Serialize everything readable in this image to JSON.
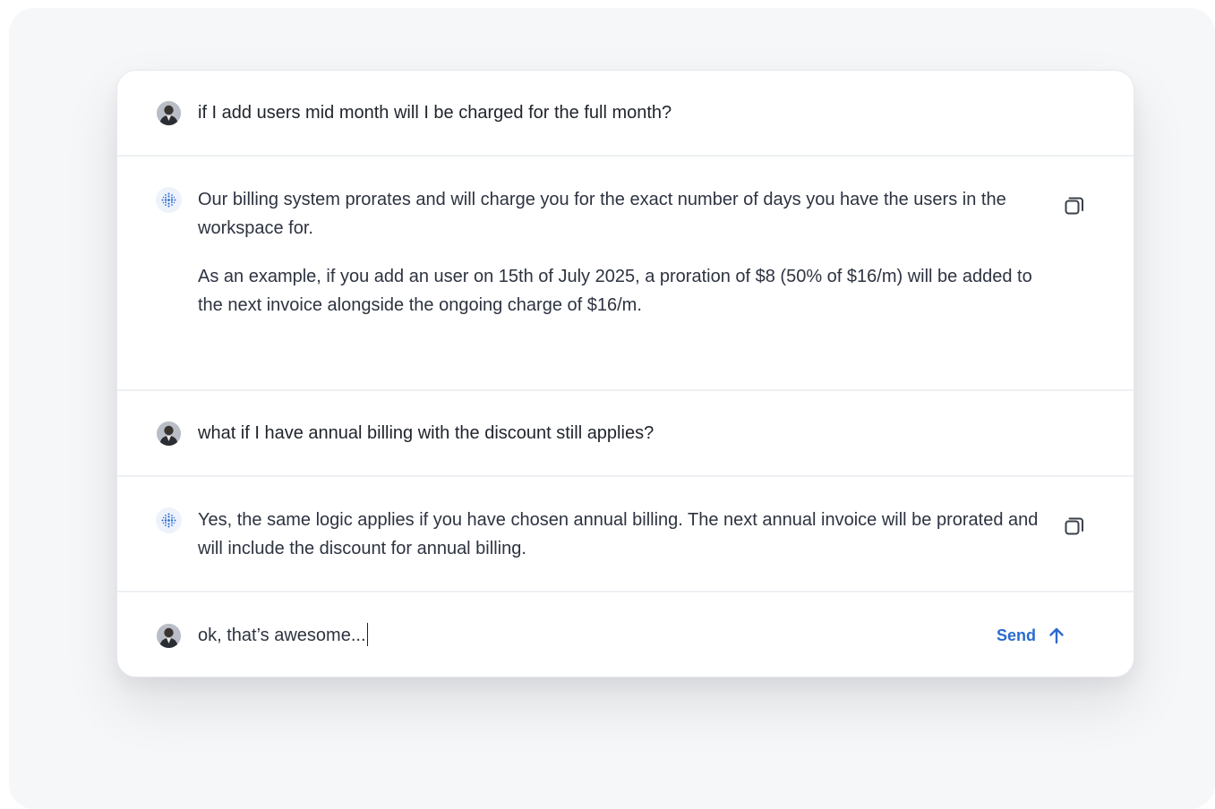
{
  "conversation": {
    "messages": [
      {
        "role": "user",
        "avatar_icon": "user-avatar-icon",
        "text": "if I add users mid month will I be charged for the full month?"
      },
      {
        "role": "assistant",
        "avatar_icon": "ai-assistant-icon",
        "paragraphs": [
          "Our billing system prorates and will charge you for the exact number of days you have the users in the workspace for.",
          "As an example, if you add an user on 15th of July 2025, a proration of $8 (50% of $16/m) will be added to the next invoice alongside the ongoing charge of $16/m."
        ],
        "action_icon": "copy-icon"
      },
      {
        "role": "user",
        "avatar_icon": "user-avatar-icon",
        "text": "what if I have annual billing with the discount still applies?"
      },
      {
        "role": "assistant",
        "avatar_icon": "ai-assistant-icon",
        "paragraphs": [
          "Yes, the same logic applies if you have chosen annual billing. The next annual invoice will be prorated and will include the discount for annual billing."
        ],
        "action_icon": "copy-icon"
      }
    ]
  },
  "composer": {
    "value": "ok, that’s awesome...",
    "send_label": "Send",
    "send_icon": "arrow-up-icon"
  },
  "colors": {
    "accent": "#2b6bcf",
    "text": "#2d3340",
    "divider": "#eef0f3",
    "background": "#f6f7f8"
  }
}
